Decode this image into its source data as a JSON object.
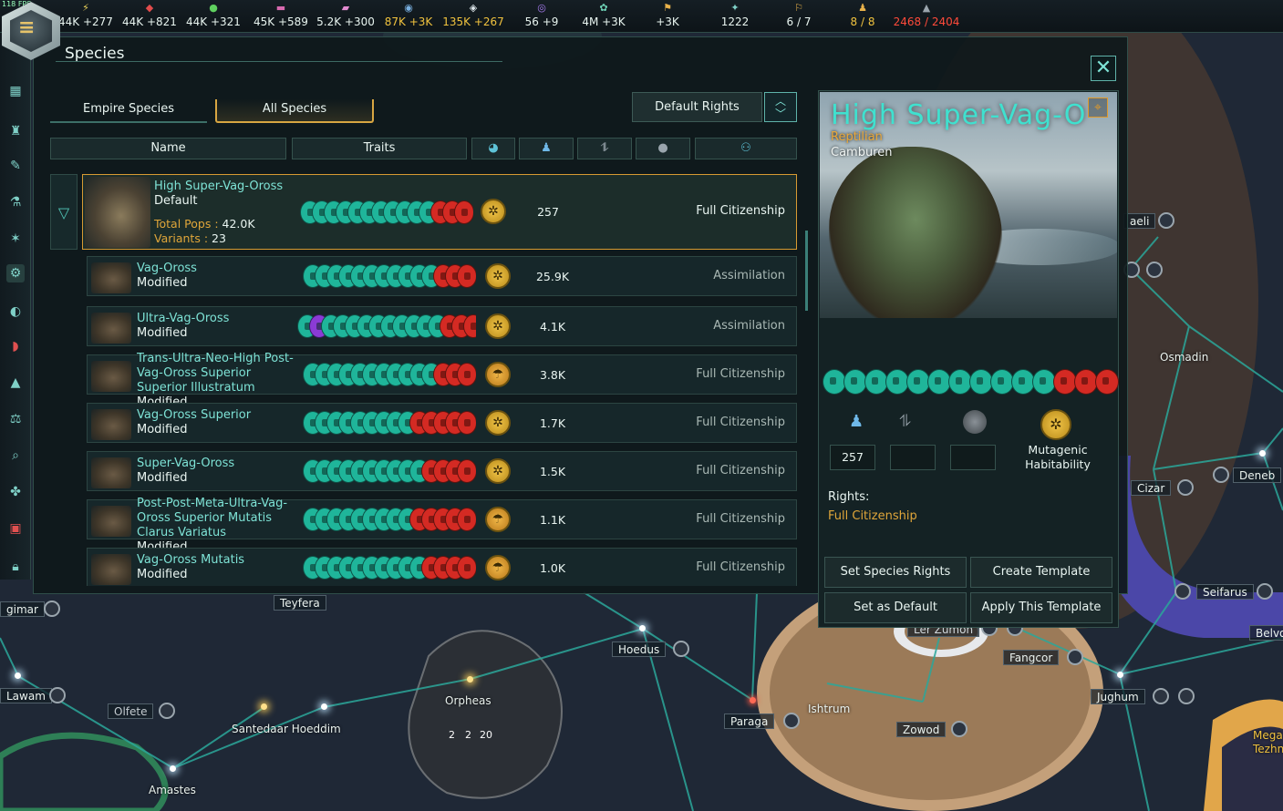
{
  "hud": {
    "fps": "118 FPS",
    "resources": [
      {
        "icon": "energy-icon",
        "value": "44K +277",
        "color": "#e8f4ef"
      },
      {
        "icon": "minerals-icon",
        "value": "44K +821",
        "color": "#e8f4ef"
      },
      {
        "icon": "food-icon",
        "value": "44K +321",
        "color": "#e8f4ef"
      },
      {
        "icon": "alloys-icon",
        "value": "45K +589",
        "color": "#e8f4ef"
      },
      {
        "icon": "consumer-goods-icon",
        "value": "5.2K +300",
        "color": "#e8f4ef"
      },
      {
        "icon": "influence-icon",
        "value": "87K +3K",
        "color": "#f0c23e"
      },
      {
        "icon": "unity-icon",
        "value": "135K +267",
        "color": "#f0c23e"
      },
      {
        "icon": "research-icon",
        "value": "56 +9",
        "color": "#e8f4ef"
      },
      {
        "icon": "amenities-icon",
        "value": "4M +3K",
        "color": "#e8f4ef"
      },
      {
        "icon": "stability-icon",
        "value": "+3K",
        "color": "#e8f4ef"
      },
      {
        "icon": "planets-icon",
        "value": "1222",
        "color": "#e8f4ef"
      },
      {
        "icon": "starbase-icon",
        "value": "6 / 7",
        "color": "#e8f4ef"
      },
      {
        "icon": "envoys-icon",
        "value": "8 / 8",
        "color": "#f0c23e"
      },
      {
        "icon": "fleet-icon",
        "value": "2468 / 2404",
        "color": "#ff4a3a"
      }
    ]
  },
  "window": {
    "title": "Species",
    "tabs": {
      "empire": "Empire Species",
      "all": "All Species"
    },
    "default_rights": "Default Rights",
    "columns": {
      "name": "Name",
      "traits": "Traits"
    }
  },
  "species": [
    {
      "name": "High Super-Vag-Oross",
      "sub": "Default",
      "pops_label": "Total Pops",
      "pops_total": "42.0K",
      "variants_label": "Variants",
      "variants": "23",
      "pops": "257",
      "rights": "Full Citizenship"
    },
    {
      "name": "Vag-Oross",
      "sub": "Modified",
      "pops": "25.9K",
      "rights": "Assimilation"
    },
    {
      "name": "Ultra-Vag-Oross",
      "sub": "Modified",
      "pops": "4.1K",
      "rights": "Assimilation"
    },
    {
      "name": "Trans-Ultra-Neo-High Post-Vag-Oross Superior Superior Illustratum",
      "sub": "Modified",
      "pops": "3.8K",
      "rights": "Full Citizenship"
    },
    {
      "name": "Vag-Oross Superior",
      "sub": "Modified",
      "pops": "1.7K",
      "rights": "Full Citizenship"
    },
    {
      "name": "Super-Vag-Oross",
      "sub": "Modified",
      "pops": "1.5K",
      "rights": "Full Citizenship"
    },
    {
      "name": "Post-Post-Meta-Ultra-Vag-Oross Superior Mutatis Clarus Variatus",
      "sub": "Modified",
      "pops": "1.1K",
      "rights": "Full Citizenship"
    },
    {
      "name": "Vag-Oross Mutatis",
      "sub": "Modified",
      "pops": "1.0K",
      "rights": "Full Citizenship"
    }
  ],
  "detail": {
    "name": "High Super-Vag-O",
    "class": "Reptilian",
    "subtitle": "Camburen",
    "pops": "257",
    "habitability": "Mutagenic Habitability",
    "rights_label": "Rights:",
    "rights_value": "Full Citizenship",
    "buttons": {
      "set_rights": "Set Species Rights",
      "create_template": "Create Template",
      "set_default": "Set as Default",
      "apply_template": "Apply This Template"
    }
  },
  "map": {
    "systems": [
      "gimar",
      "Lawam",
      "Olfete",
      "Santedaar Hoeddim",
      "Amastes",
      "Orpheas",
      "Hoedus",
      "Paraga",
      "Ishtrum",
      "Zowod",
      "Fangcor",
      "Ler Zumon",
      "Jughum",
      "Seifarus",
      "Cizar",
      "Deneb",
      "Osmadin",
      "aeli",
      "Belvo",
      "Teyfera",
      "Mega Tezhn"
    ],
    "orpheas_stats": [
      "2",
      "2",
      "20"
    ]
  }
}
